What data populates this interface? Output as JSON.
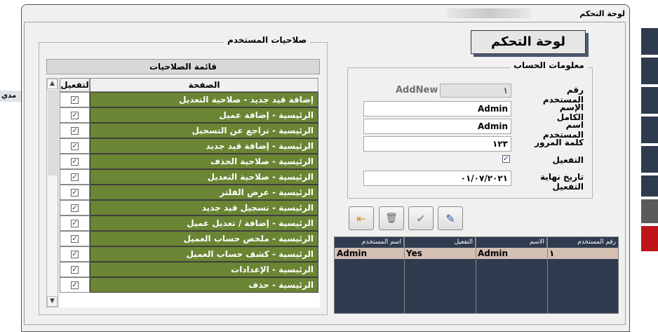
{
  "background_app": {
    "left_tab": "مدي"
  },
  "window": {
    "title": "لوحة التحكم",
    "blurred_caption": ""
  },
  "header": {
    "title": "لوحة التحكم"
  },
  "account_info": {
    "legend": "معلومات الحساب",
    "user_number_label": "رقم المستخدم",
    "user_number_value": "١",
    "addnew_label": "AddNew",
    "full_name_label": "الإسم الكامل",
    "full_name_value": "Admin",
    "username_label": "اسم المستخدم",
    "username_value": "Admin",
    "password_label": "كلمة المرور",
    "password_value": "١٢٣",
    "activation_label": "التفعيل",
    "activation_checked": true,
    "expiry_label": "تاريخ نهاية التفعيل",
    "expiry_value": "٠١/٠٧/٢٠٢١"
  },
  "toolbar": {
    "buttons": [
      {
        "icon": "exit-icon"
      },
      {
        "icon": "delete-icon"
      },
      {
        "icon": "save-check-icon"
      },
      {
        "icon": "edit-pencil-icon"
      }
    ]
  },
  "accounts_grid": {
    "headers": [
      "اسم المستخدم",
      "التفعيل",
      "الاسم",
      "رقم المستخدم"
    ],
    "rows": [
      {
        "username": "Admin",
        "active": "Yes",
        "name": "Admin",
        "id": "١"
      }
    ]
  },
  "permissions": {
    "legend": "صلاحيات المستخدم",
    "list_title": "قائمة الصلاحيات",
    "col_page": "الصفحة",
    "col_active": "لتفعيل",
    "rows": [
      {
        "page": "إضافة قيد جديد - صلاحية التعديل",
        "active": true
      },
      {
        "page": "الرئيسية - إضافة عميل",
        "active": true
      },
      {
        "page": "الرئيسية - تراجع عن التسجيل",
        "active": true
      },
      {
        "page": "الرئيسية - إضافة قيد جديد",
        "active": true
      },
      {
        "page": "الرئيسية - صلاحية الحذف",
        "active": true
      },
      {
        "page": "الرئيسية - صلاحية التعديل",
        "active": true
      },
      {
        "page": "الرئيسية - عرض الفلتر",
        "active": true
      },
      {
        "page": "الرئيسية - تسجيل قيد جديد",
        "active": true
      },
      {
        "page": "الرئيسية - إضافة / تعديل عميل",
        "active": true
      },
      {
        "page": "الرئيسية - ملخص حساب العميل",
        "active": true
      },
      {
        "page": "الرئيسية - كشف حساب العميل",
        "active": true
      },
      {
        "page": "الرئيسية - الإعدادات",
        "active": true
      },
      {
        "page": "الرئيسية - حذف",
        "active": true
      }
    ]
  },
  "colors": {
    "row_green": "#6a8533",
    "grid_dark": "#2f3b4f",
    "selected_row": "#d4bfb3",
    "side_bar": "#2e3a4e",
    "side_red": "#c0141c"
  }
}
